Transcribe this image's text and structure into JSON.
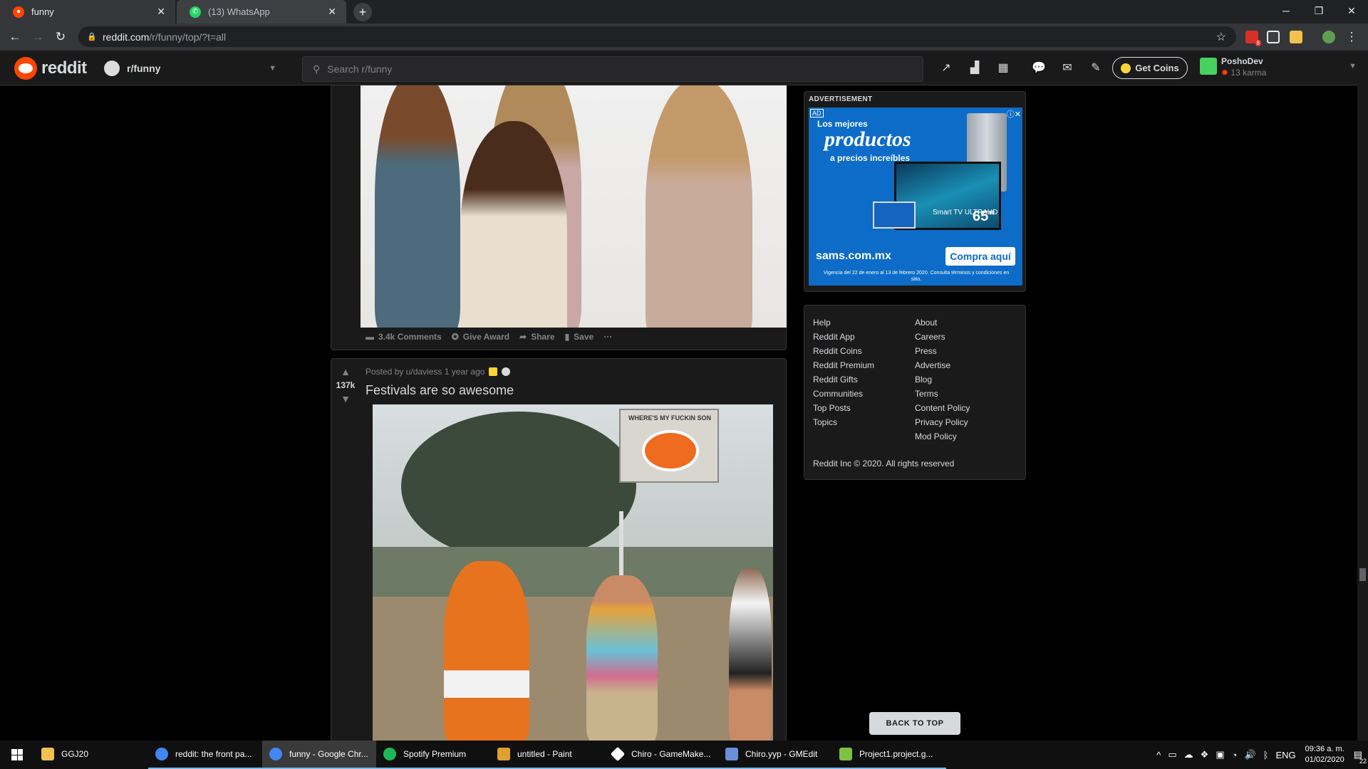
{
  "browser": {
    "tabs": [
      {
        "title": "funny",
        "active": true
      },
      {
        "title": "(13) WhatsApp",
        "active": false
      }
    ],
    "url_host": "reddit.com",
    "url_path": "/r/funny/top/?t=all",
    "ext_badge": "8"
  },
  "reddit_header": {
    "wordmark": "reddit",
    "subreddit": "r/funny",
    "search_placeholder": "Search r/funny",
    "get_coins": "Get Coins",
    "username": "PoshoDev",
    "karma": "13 karma"
  },
  "post1": {
    "actions": {
      "comments": "3.4k Comments",
      "award": "Give Award",
      "share": "Share",
      "save": "Save",
      "more": "···"
    }
  },
  "post2": {
    "score": "137k",
    "meta": "Posted by u/daviess 1 year ago",
    "title": "Festivals are so awesome",
    "sign_text": "WHERE'S MY FUCKIN SON"
  },
  "advertisement": {
    "label": "ADVERTISEMENT",
    "ad_tag": "AD",
    "line1": "Los mejores",
    "line2": "productos",
    "line3": "a precios increíbles",
    "tv_text": "Smart TV ULTRAHD",
    "tv_size": "65\"",
    "site": "sams.com.mx",
    "cta": "Compra aquí",
    "fine_print": "Vigencia del 22 de enero al 13 de febrero 2020. Consulta términos y condiciones en sitio."
  },
  "footer": {
    "col1": [
      "Help",
      "Reddit App",
      "Reddit Coins",
      "Reddit Premium",
      "Reddit Gifts",
      "Communities",
      "Top Posts",
      "Topics"
    ],
    "col2": [
      "About",
      "Careers",
      "Press",
      "Advertise",
      "Blog",
      "Terms",
      "Content Policy",
      "Privacy Policy",
      "Mod Policy"
    ],
    "copyright": "Reddit Inc © 2020. All rights reserved"
  },
  "back_to_top": "BACK TO TOP",
  "taskbar": {
    "items": [
      {
        "label": "GGJ20",
        "color": "#f2c14e"
      },
      {
        "label": "reddit: the front pa...",
        "color": "#4285f4"
      },
      {
        "label": "funny - Google Chr...",
        "color": "#4285f4"
      },
      {
        "label": "Spotify Premium",
        "color": "#1db954"
      },
      {
        "label": "untitled - Paint",
        "color": "#e0a030"
      },
      {
        "label": "Chiro - GameMake...",
        "color": "#ffffff"
      },
      {
        "label": "Chiro.yyp - GMEdit",
        "color": "#6a8fd8"
      },
      {
        "label": "Project1.project.g...",
        "color": "#7ec242"
      }
    ],
    "lang": "ENG",
    "time": "09:36 a. m.",
    "date": "01/02/2020",
    "notifications": "22"
  },
  "colors": {
    "reddit_orange": "#ff4500",
    "background": "#000000",
    "card": "#1a1a1b",
    "border": "#343536"
  }
}
